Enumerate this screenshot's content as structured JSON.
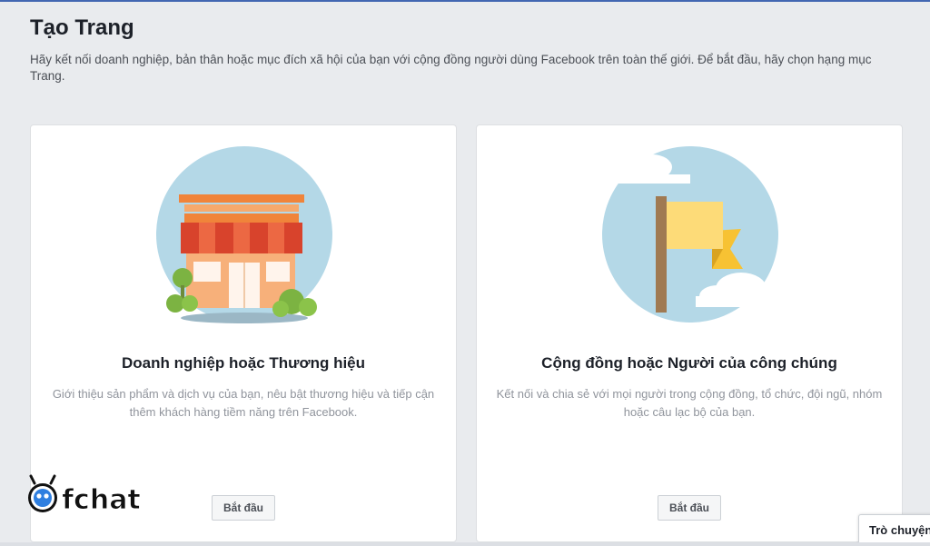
{
  "page": {
    "title": "Tạo Trang",
    "intro": "Hãy kết nối doanh nghiệp, bản thân hoặc mục đích xã hội của bạn với cộng đồng người dùng Facebook trên toàn thế giới. Để bắt đầu, hãy chọn hạng mục Trang."
  },
  "cards": [
    {
      "title": "Doanh nghiệp hoặc Thương hiệu",
      "description": "Giới thiệu sản phẩm và dịch vụ của bạn, nêu bật thương hiệu và tiếp cận thêm khách hàng tiềm năng trên Facebook.",
      "button": "Bắt đầu",
      "illustration": "storefront-icon"
    },
    {
      "title": "Cộng đồng hoặc Người của công chúng",
      "description": "Kết nối và chia sẻ với mọi người trong cộng đồng, tổ chức, đội ngũ, nhóm hoặc câu lạc bộ của bạn.",
      "button": "Bắt đầu",
      "illustration": "flag-icon"
    }
  ],
  "chat": {
    "label": "Trò chuyện"
  },
  "watermark": {
    "text": "fchat"
  },
  "colors": {
    "accent": "#4267b2",
    "background": "#e9ebee",
    "circle": "#b4d8e7"
  }
}
